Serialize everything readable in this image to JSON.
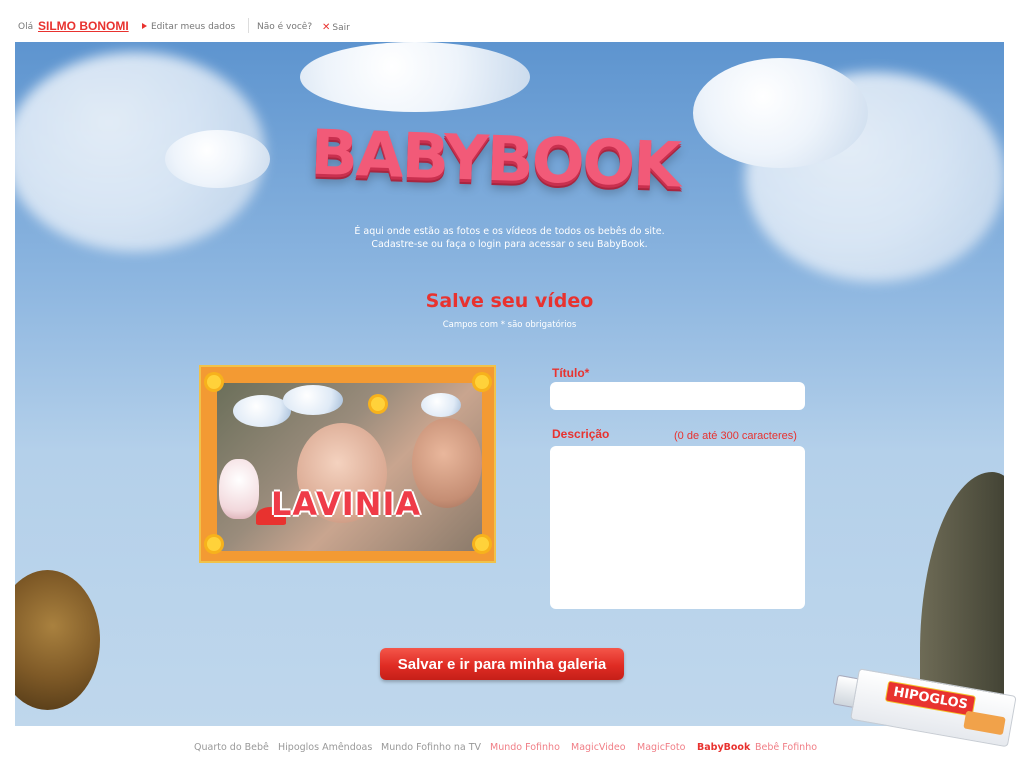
{
  "topbar": {
    "hello": "Olá",
    "user_name": "SILMO BONOMI",
    "edit_label": "Editar meus dados",
    "not_you": "Não é você?",
    "logout_label": "Sair"
  },
  "hero": {
    "logo_text": "BABYBOOK",
    "intro_line1": "É aqui onde estão as fotos e os vídeos de todos os bebês do site.",
    "intro_line2": "Cadastre-se ou faça o login para acessar o seu BabyBook."
  },
  "form": {
    "heading": "Salve seu vídeo",
    "required_note": "Campos com * são obrigatórios",
    "video_caption": "LAVINIA",
    "title_label": "Título*",
    "title_value": "",
    "description_label": "Descrição",
    "description_hint": "(0 de até 300 caracteres)",
    "description_value": "",
    "submit_label": "Salvar e ir para minha galeria"
  },
  "product": {
    "brand": "HIPOGLOS"
  },
  "footer": {
    "links": [
      {
        "label": "Quarto do Bebê",
        "color": "#999999"
      },
      {
        "label": "Hipoglos Amêndoas",
        "color": "#999999"
      },
      {
        "label": "Mundo Fofinho na TV",
        "color": "#999999"
      },
      {
        "label": "Mundo Fofinho",
        "color": "#f07e86"
      },
      {
        "label": "MagicVideo",
        "color": "#f07e86"
      },
      {
        "label": "MagicFoto",
        "color": "#f07e86"
      },
      {
        "label": "BabyBook",
        "color": "#e8322f"
      },
      {
        "label": "Bebê Fofinho",
        "color": "#f07e86"
      }
    ]
  },
  "colors": {
    "accent": "#e8322f",
    "sky_top": "#5d94cf",
    "sky_bottom": "#bfd7ec"
  }
}
